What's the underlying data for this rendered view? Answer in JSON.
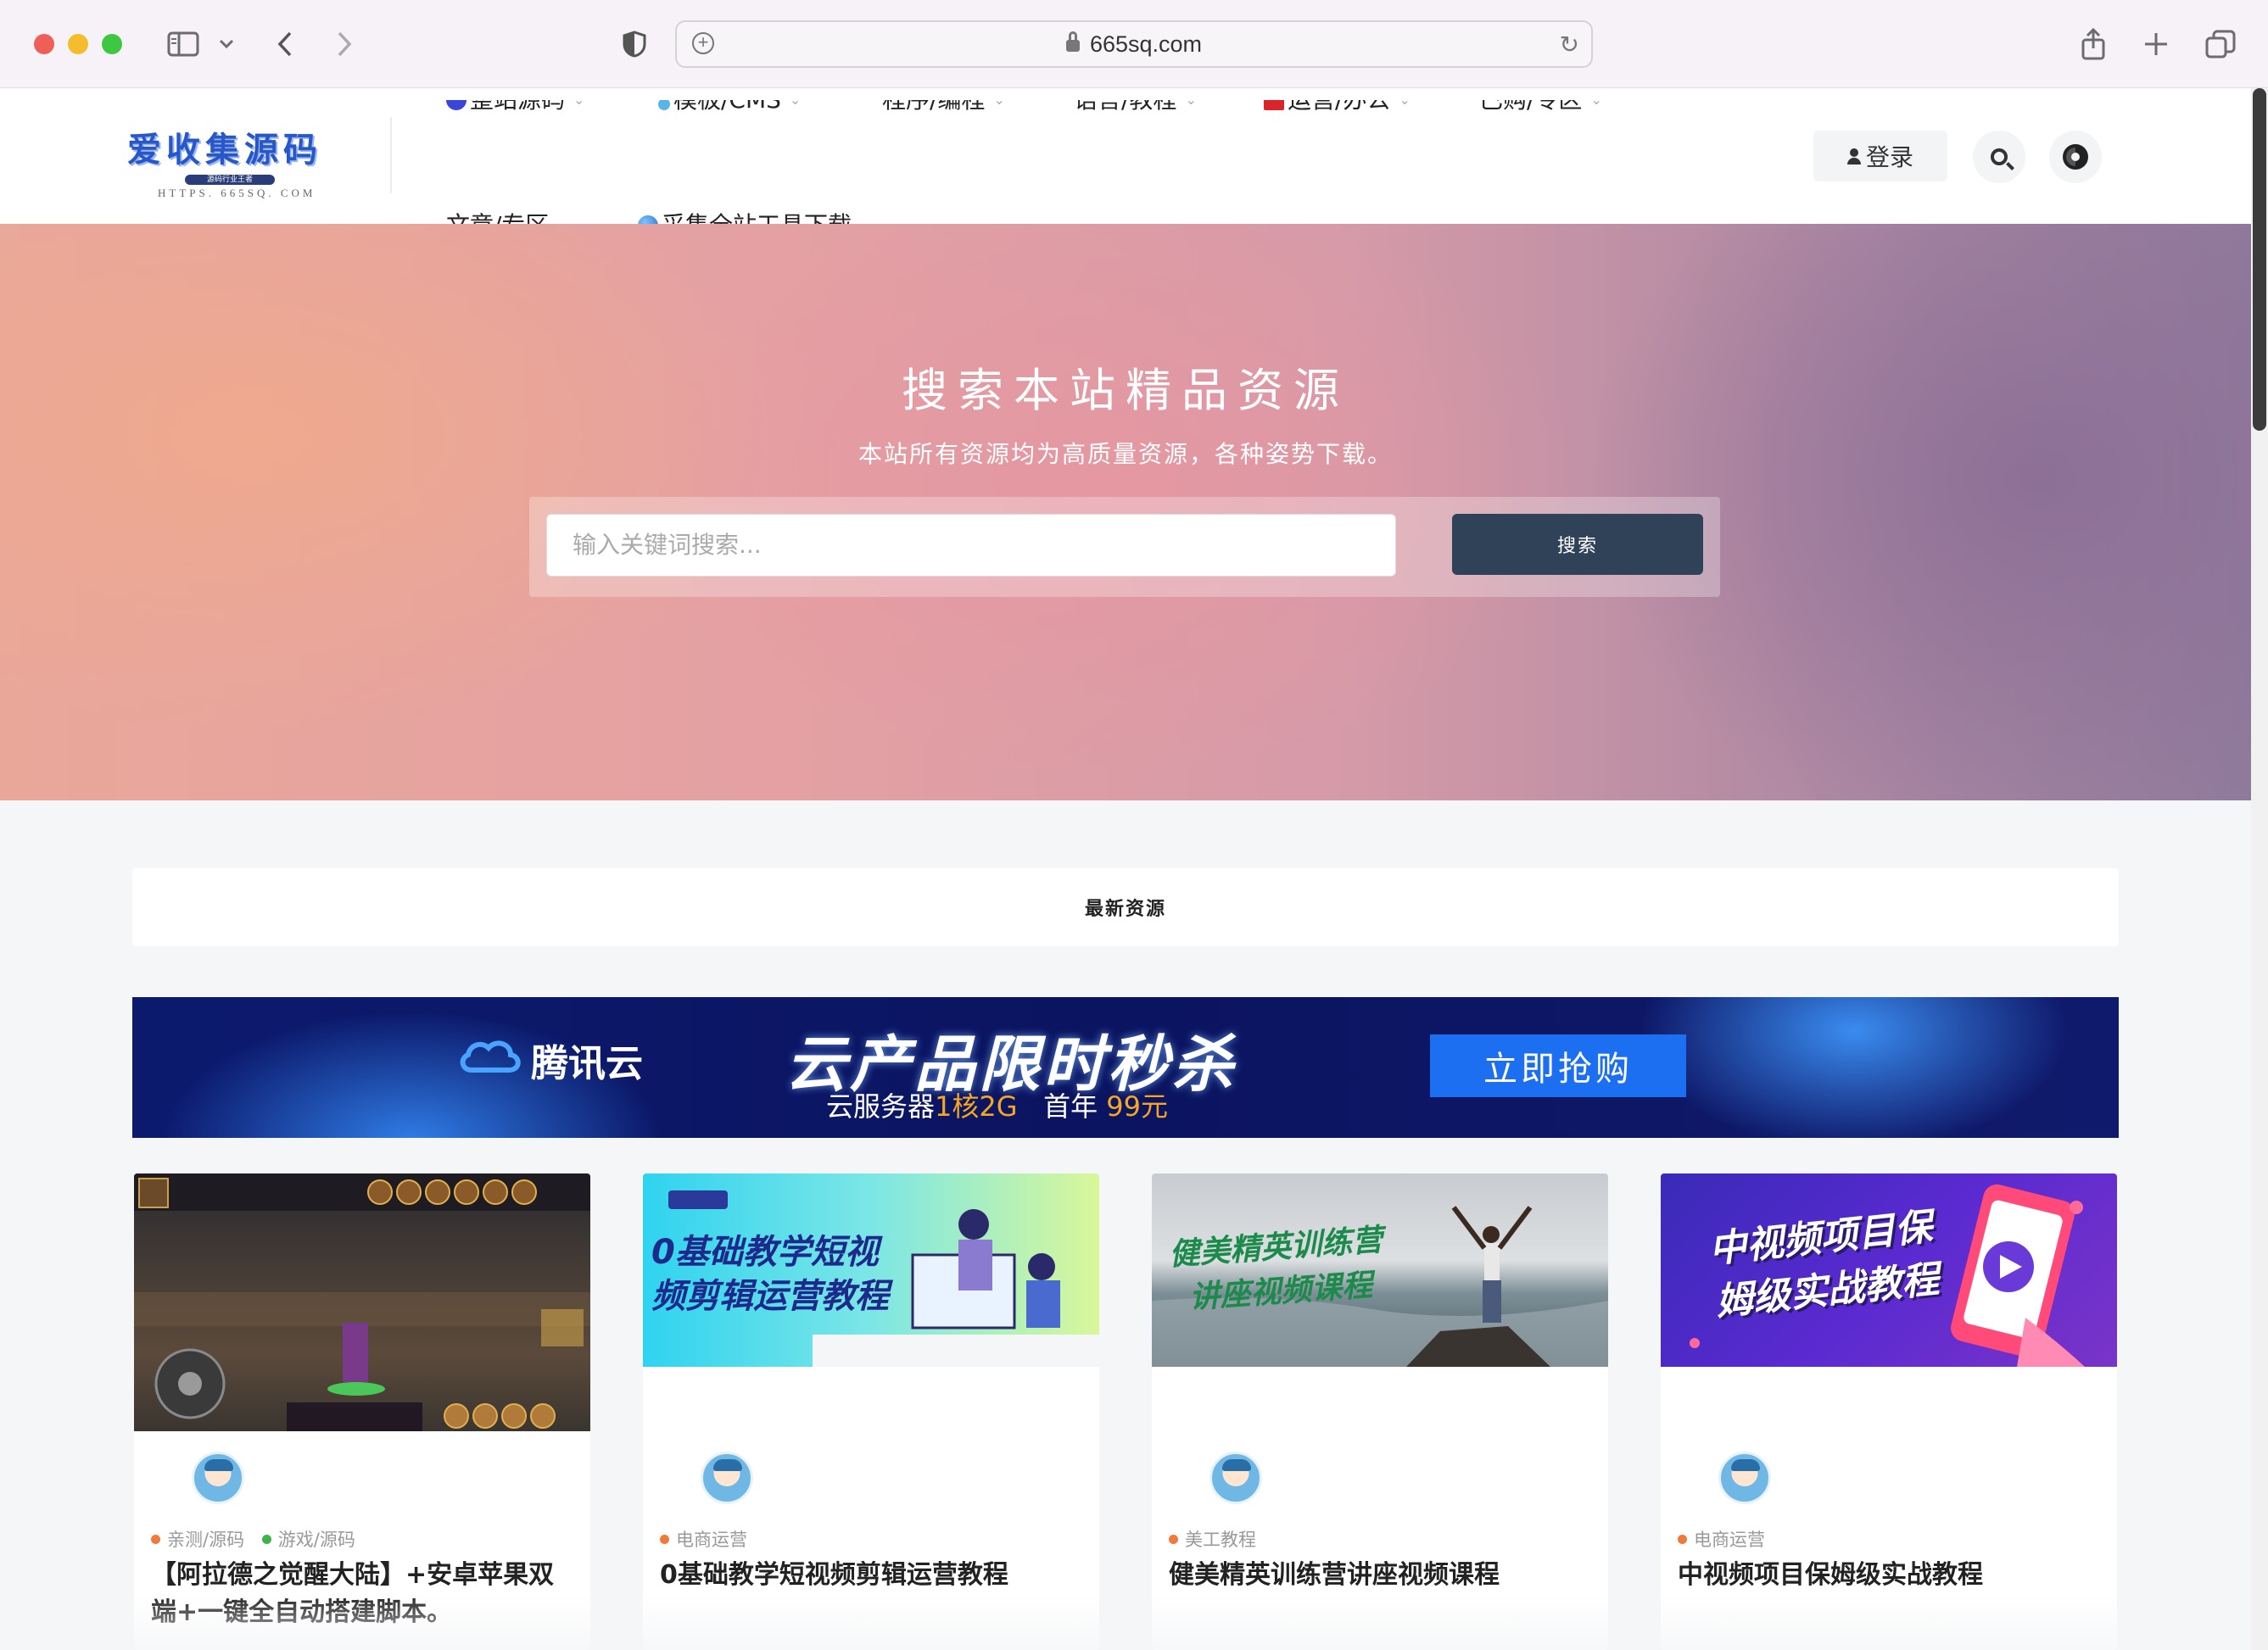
{
  "browser": {
    "url": "665sq.com"
  },
  "header": {
    "logo_text": "爱收集源码",
    "logo_badge": "源码行业王者",
    "logo_url": "HTTPS. 665SQ. COM",
    "nav_top": [
      "整站源码",
      "模板/CMS",
      "程序/编程",
      "语言/教程",
      "运营/办公",
      "已购/专区"
    ],
    "nav_bottom": [
      "文章/专区",
      "采集全站工具下载"
    ],
    "login_label": "登录"
  },
  "hero": {
    "title": "搜索本站精品资源",
    "subtitle": "本站所有资源均为高质量资源，各种姿势下载。",
    "search_placeholder": "输入关键词搜索...",
    "search_button": "搜索"
  },
  "section": {
    "title": "最新资源"
  },
  "ad": {
    "brand": "腾讯云",
    "headline": "云产品限时秒杀",
    "sub_prefix": "云服务器",
    "sub_highlight1": "1核2G",
    "sub_middle": "首年",
    "sub_highlight2": "99元",
    "cta": "立即抢购"
  },
  "cards": [
    {
      "categories": [
        {
          "label": "亲测/源码",
          "color": "#f07a3a"
        },
        {
          "label": "游戏/源码",
          "color": "#3cb44b"
        }
      ],
      "title": "【阿拉德之觉醒大陆】+安卓苹果双端+一键全自动搭建脚本。"
    },
    {
      "thumb_text_1": "0基础教学短视",
      "thumb_text_2": "频剪辑运营教程",
      "categories": [
        {
          "label": "电商运营",
          "color": "#f07a3a"
        }
      ],
      "title": "0基础教学短视频剪辑运营教程"
    },
    {
      "thumb_text_1": "健美精英训练营",
      "thumb_text_2": "讲座视频课程",
      "categories": [
        {
          "label": "美工教程",
          "color": "#f07a3a"
        }
      ],
      "title": "健美精英训练营讲座视频课程"
    },
    {
      "thumb_text_1": "中视频项目保",
      "thumb_text_2": "姆级实战教程",
      "categories": [
        {
          "label": "电商运营",
          "color": "#f07a3a"
        }
      ],
      "title": "中视频项目保姆级实战教程"
    }
  ]
}
